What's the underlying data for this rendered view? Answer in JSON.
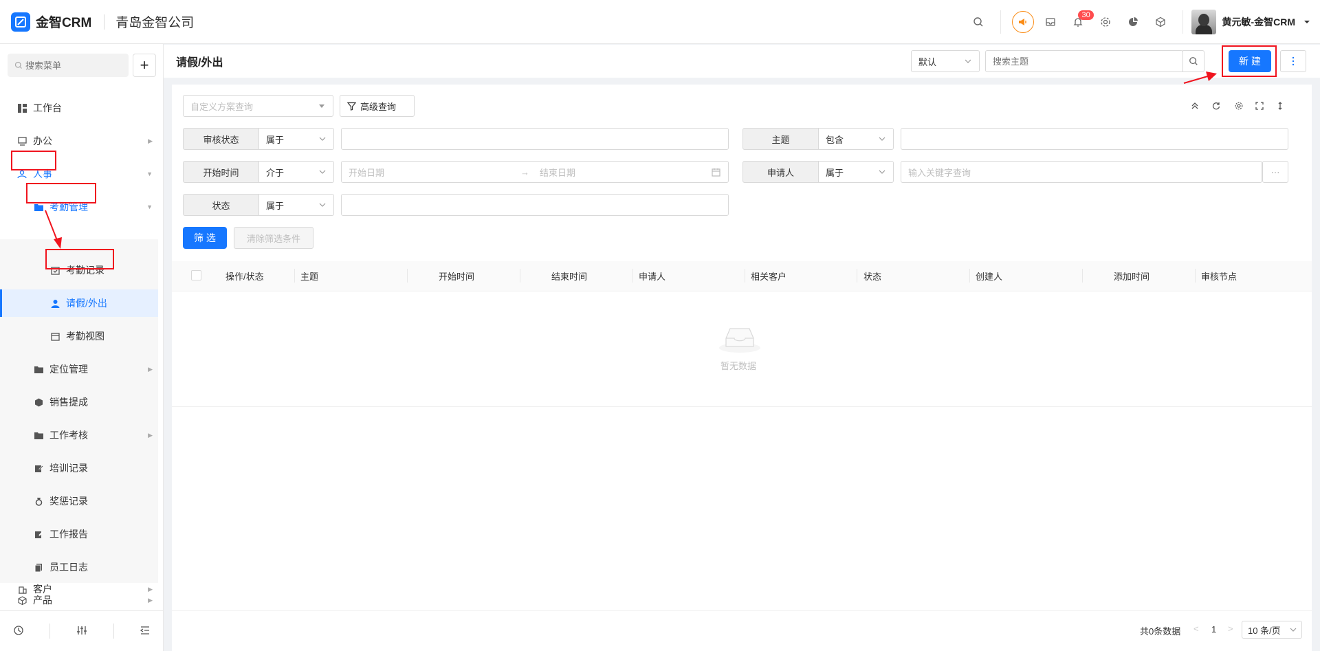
{
  "app": {
    "logo_text": "金智CRM",
    "company": "青岛金智公司",
    "notification_count": "30",
    "user_name": "黄元敏-金智CRM"
  },
  "sidebar": {
    "search_placeholder": "搜索菜单",
    "items": [
      {
        "label": "工作台",
        "icon": "dashboard-icon"
      },
      {
        "label": "办公",
        "icon": "desktop-icon"
      },
      {
        "label": "人事",
        "icon": "people-icon"
      },
      {
        "label": "考勤管理",
        "icon": "folder-icon"
      },
      {
        "label": "考勤记录",
        "icon": "calendar-check-icon"
      },
      {
        "label": "请假/外出",
        "icon": "user-icon"
      },
      {
        "label": "考勤视图",
        "icon": "calendar-icon"
      },
      {
        "label": "定位管理",
        "icon": "folder-icon"
      },
      {
        "label": "销售提成",
        "icon": "hexagon-icon"
      },
      {
        "label": "工作考核",
        "icon": "folder-icon"
      },
      {
        "label": "培训记录",
        "icon": "edit-icon"
      },
      {
        "label": "奖惩记录",
        "icon": "medal-icon"
      },
      {
        "label": "工作报告",
        "icon": "edit-icon"
      },
      {
        "label": "员工日志",
        "icon": "copy-icon"
      },
      {
        "label": "产品",
        "icon": "cube-icon"
      },
      {
        "label": "客户",
        "icon": "building-icon"
      }
    ]
  },
  "header": {
    "title": "请假/外出",
    "view_select": "默认",
    "search_placeholder": "搜索主题",
    "new_button": "新 建"
  },
  "filters": {
    "scheme_placeholder": "自定义方案查询",
    "advanced_query": "高级查询",
    "rows": [
      {
        "label": "审核状态",
        "op": "属于"
      },
      {
        "label": "主题",
        "op": "包含"
      },
      {
        "label": "开始时间",
        "op": "介于"
      },
      {
        "label": "申请人",
        "op": "属于"
      },
      {
        "label": "状态",
        "op": "属于"
      }
    ],
    "start_date_placeholder": "开始日期",
    "end_date_placeholder": "结束日期",
    "keyword_placeholder": "输入关键字查询",
    "more_button": "···",
    "filter_button": "筛 选",
    "clear_button": "清除筛选条件"
  },
  "table": {
    "columns": [
      "操作/状态",
      "主题",
      "开始时间",
      "结束时间",
      "申请人",
      "相关客户",
      "状态",
      "创建人",
      "添加时间",
      "审核节点"
    ],
    "empty_text": "暂无数据"
  },
  "pagination": {
    "total": "共0条数据",
    "page": "1",
    "page_size": "10 条/页"
  },
  "colors": {
    "accent": "#1677ff",
    "annotation_red": "#f0141e"
  }
}
